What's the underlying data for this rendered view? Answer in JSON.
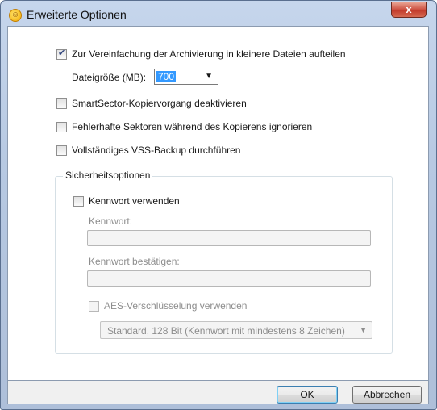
{
  "window": {
    "title": "Erweiterte Optionen",
    "close_glyph": "x"
  },
  "options": {
    "split": {
      "label": "Zur Vereinfachung der Archivierung in kleinere Dateien aufteilen",
      "checked": true
    },
    "filesize": {
      "label": "Dateigröße (MB):",
      "value": "700"
    },
    "smartsector": {
      "label": "SmartSector-Kopiervorgang deaktivieren",
      "checked": false
    },
    "badsectors": {
      "label": "Fehlerhafte Sektoren während des Kopierens ignorieren",
      "checked": false
    },
    "vss": {
      "label": "Vollständiges VSS-Backup durchführen",
      "checked": false
    }
  },
  "security": {
    "group_title": "Sicherheitsoptionen",
    "use_password": {
      "label": "Kennwort verwenden",
      "checked": false
    },
    "password_label": "Kennwort:",
    "confirm_label": "Kennwort bestätigen:",
    "aes": {
      "label": "AES-Verschlüsselung verwenden",
      "checked": false
    },
    "cipher_value": "Standard, 128 Bit (Kennwort mit mindestens 8 Zeichen)"
  },
  "buttons": {
    "ok": "OK",
    "cancel": "Abbrechen"
  },
  "colors": {
    "selection": "#3399ff",
    "close": "#c23b2b",
    "frame": "#b7c9e2"
  }
}
